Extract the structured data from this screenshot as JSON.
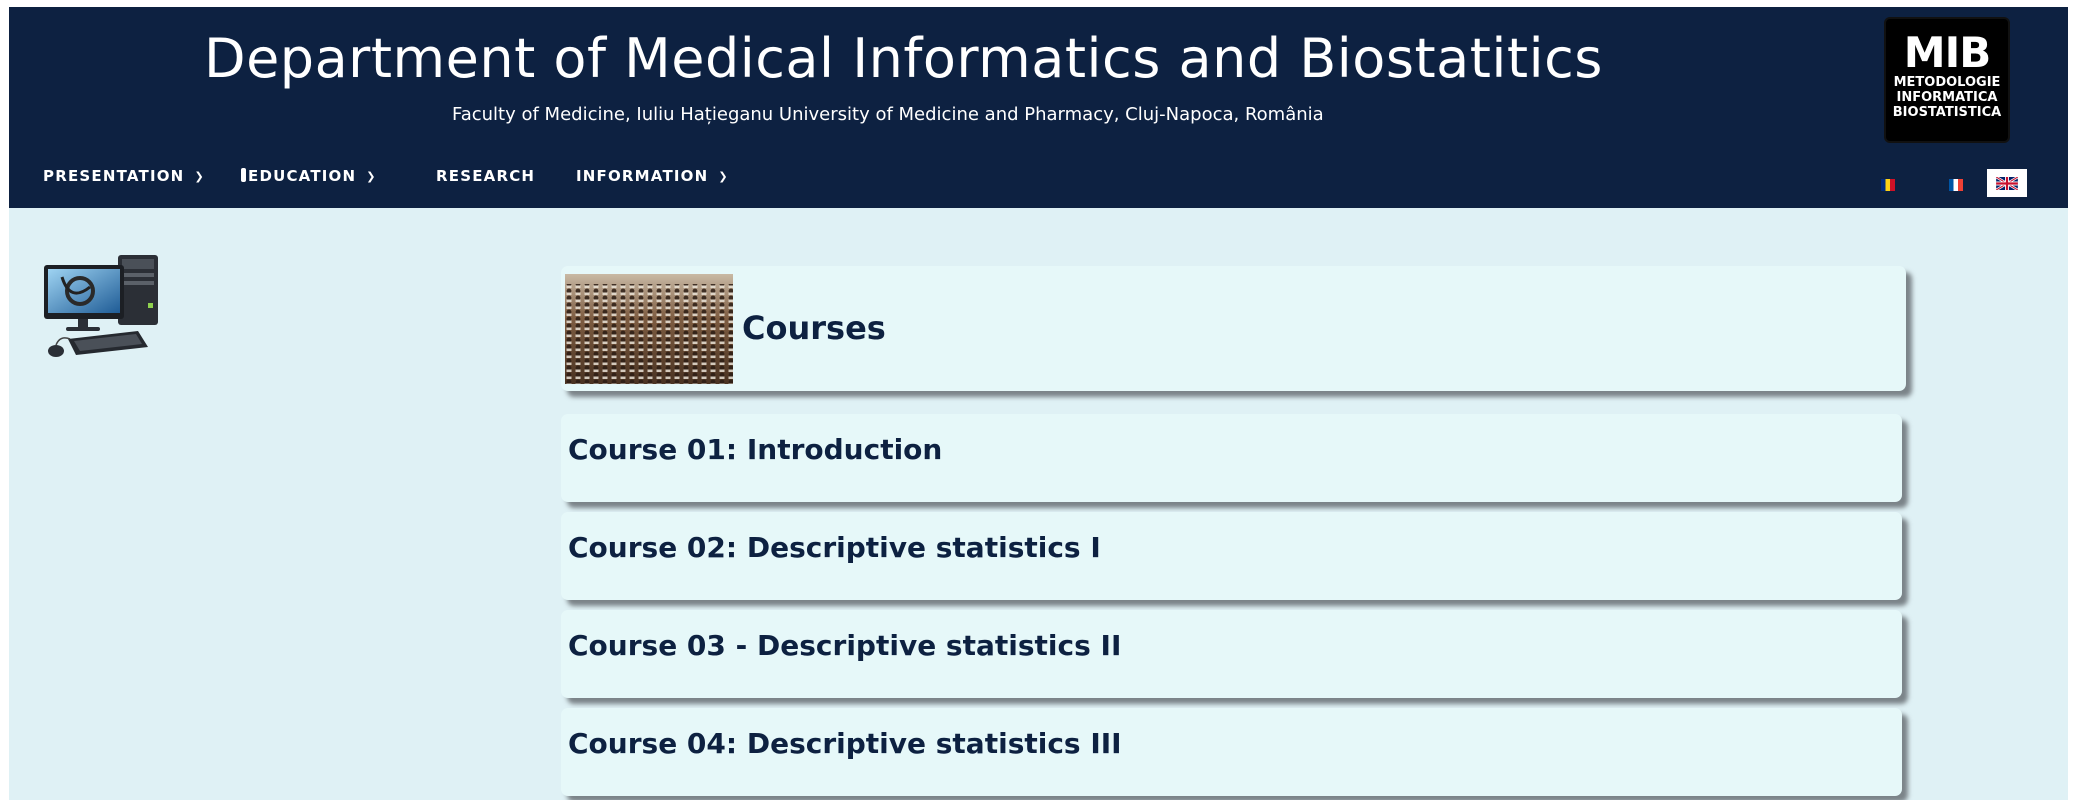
{
  "header": {
    "title": "Department of Medical Informatics and Biostatitics",
    "subtitle": "Faculty of Medicine, Iuliu Hațieganu University of Medicine and Pharmacy, Cluj-Napoca, România",
    "logo": {
      "mark": "MIB",
      "lines": [
        "METODOLOGIE",
        "INFORMATICA",
        "BIOSTATISTICA"
      ]
    }
  },
  "nav": {
    "items": [
      {
        "label": "PRESENTATION",
        "has_dropdown": true,
        "icon": "chevron-down-icon"
      },
      {
        "label": "EDUCATION",
        "has_dropdown": true,
        "icon": "chevron-down-icon"
      },
      {
        "label": "RESEARCH",
        "has_dropdown": false
      },
      {
        "label": "INFORMATION",
        "has_dropdown": true,
        "icon": "chevron-down-icon"
      }
    ],
    "languages": [
      {
        "code": "ro",
        "icon": "romania-flag-icon"
      },
      {
        "code": "fr",
        "icon": "france-flag-icon"
      },
      {
        "code": "en",
        "icon": "uk-flag-icon",
        "active": true
      }
    ]
  },
  "sidebar": {
    "icon": "computer-stethoscope-icon"
  },
  "main": {
    "section_title": "Courses",
    "section_image": "lecture-hall-image",
    "courses": [
      {
        "label": "Course 01: Introduction"
      },
      {
        "label": "Course 02: Descriptive statistics I"
      },
      {
        "label": "Course 03 - Descriptive statistics II"
      },
      {
        "label": "Course 04: Descriptive statistics III"
      }
    ]
  },
  "colors": {
    "header_bg": "#0d2141",
    "page_bg": "#dff1f5",
    "card_bg": "#e6f8f9",
    "heading_text": "#0d2141"
  }
}
